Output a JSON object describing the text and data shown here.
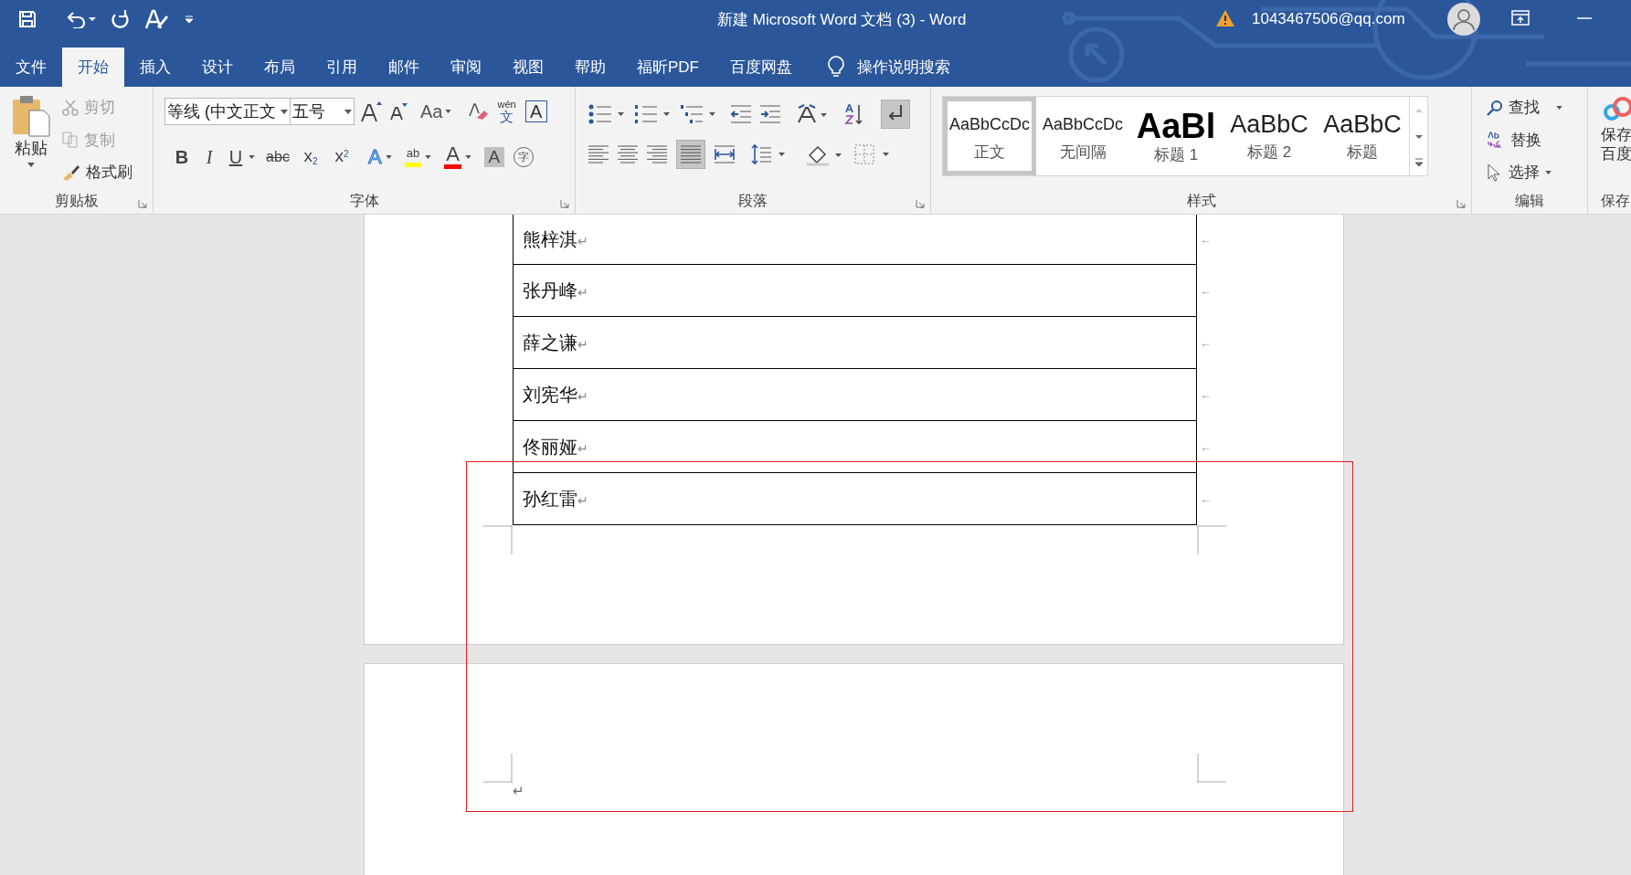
{
  "window": {
    "title": "新建 Microsoft Word 文档 (3)  -  Word",
    "account": "1043467506@qq.com"
  },
  "tabs": [
    {
      "label": "文件",
      "selected": false
    },
    {
      "label": "开始",
      "selected": true
    },
    {
      "label": "插入",
      "selected": false
    },
    {
      "label": "设计",
      "selected": false
    },
    {
      "label": "布局",
      "selected": false
    },
    {
      "label": "引用",
      "selected": false
    },
    {
      "label": "邮件",
      "selected": false
    },
    {
      "label": "审阅",
      "selected": false
    },
    {
      "label": "视图",
      "selected": false
    },
    {
      "label": "帮助",
      "selected": false
    },
    {
      "label": "福昕PDF",
      "selected": false
    },
    {
      "label": "百度网盘",
      "selected": false
    }
  ],
  "tell_me": "操作说明搜索",
  "clipboard": {
    "label": "剪贴板",
    "paste": "粘贴",
    "cut": "剪切",
    "copy": "复制",
    "format_painter": "格式刷"
  },
  "font": {
    "label": "字体",
    "font_name": "等线 (中文正文",
    "font_size": "五号",
    "change_case": "Aa",
    "phonetic": "wén",
    "phonetic_char": "文",
    "border_char": "A",
    "bold": "B",
    "italic": "I",
    "underline": "U",
    "strike": "abc",
    "sub": "x",
    "sub_mark": "2",
    "sup": "x",
    "sup_mark": "2",
    "effects": "A",
    "highlight": "ab",
    "font_color": "A",
    "shading": "A",
    "enclose": "字"
  },
  "paragraph": {
    "label": "段落"
  },
  "styles": {
    "label": "样式",
    "items": [
      {
        "sample": "AaBbCcDc",
        "name": "正文",
        "kind": "marked",
        "selected": true
      },
      {
        "sample": "AaBbCcDc",
        "name": "无间隔",
        "kind": "marked",
        "selected": false
      },
      {
        "sample": "AaBl",
        "name": "标题 1",
        "kind": "heading1",
        "selected": false
      },
      {
        "sample": "AaBbC",
        "name": "标题 2",
        "kind": "heading2",
        "selected": false
      },
      {
        "sample": "AaBbC",
        "name": "标题",
        "kind": "title",
        "selected": false
      }
    ]
  },
  "editing": {
    "label": "编辑",
    "find": "查找",
    "replace": "替换",
    "select": "选择"
  },
  "baidu": {
    "line1": "保存",
    "line2": "百度",
    "label": "保存"
  },
  "table": {
    "rows": [
      {
        "name": "熊梓淇",
        "cell_mark": "↵",
        "row_mark": "←"
      },
      {
        "name": "张丹峰",
        "cell_mark": "↵",
        "row_mark": "←"
      },
      {
        "name": "薛之谦",
        "cell_mark": "↵",
        "row_mark": "←"
      },
      {
        "name": "刘宪华",
        "cell_mark": "↵",
        "row_mark": "←"
      },
      {
        "name": "佟丽娅",
        "cell_mark": "↵",
        "row_mark": "←"
      },
      {
        "name": "孙红雷",
        "cell_mark": "↵",
        "row_mark": "←"
      }
    ]
  },
  "page2": {
    "paragraph_mark": "↵"
  }
}
